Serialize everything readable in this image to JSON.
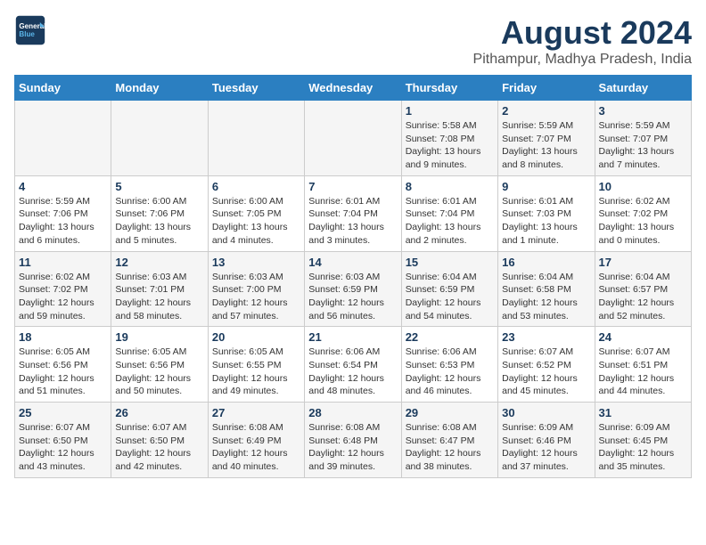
{
  "header": {
    "logo_line1": "General",
    "logo_line2": "Blue",
    "main_title": "August 2024",
    "subtitle": "Pithampur, Madhya Pradesh, India"
  },
  "days_of_week": [
    "Sunday",
    "Monday",
    "Tuesday",
    "Wednesday",
    "Thursday",
    "Friday",
    "Saturday"
  ],
  "weeks": [
    [
      {
        "day": "",
        "detail": ""
      },
      {
        "day": "",
        "detail": ""
      },
      {
        "day": "",
        "detail": ""
      },
      {
        "day": "",
        "detail": ""
      },
      {
        "day": "1",
        "detail": "Sunrise: 5:58 AM\nSunset: 7:08 PM\nDaylight: 13 hours and 9 minutes."
      },
      {
        "day": "2",
        "detail": "Sunrise: 5:59 AM\nSunset: 7:07 PM\nDaylight: 13 hours and 8 minutes."
      },
      {
        "day": "3",
        "detail": "Sunrise: 5:59 AM\nSunset: 7:07 PM\nDaylight: 13 hours and 7 minutes."
      }
    ],
    [
      {
        "day": "4",
        "detail": "Sunrise: 5:59 AM\nSunset: 7:06 PM\nDaylight: 13 hours and 6 minutes."
      },
      {
        "day": "5",
        "detail": "Sunrise: 6:00 AM\nSunset: 7:06 PM\nDaylight: 13 hours and 5 minutes."
      },
      {
        "day": "6",
        "detail": "Sunrise: 6:00 AM\nSunset: 7:05 PM\nDaylight: 13 hours and 4 minutes."
      },
      {
        "day": "7",
        "detail": "Sunrise: 6:01 AM\nSunset: 7:04 PM\nDaylight: 13 hours and 3 minutes."
      },
      {
        "day": "8",
        "detail": "Sunrise: 6:01 AM\nSunset: 7:04 PM\nDaylight: 13 hours and 2 minutes."
      },
      {
        "day": "9",
        "detail": "Sunrise: 6:01 AM\nSunset: 7:03 PM\nDaylight: 13 hours and 1 minute."
      },
      {
        "day": "10",
        "detail": "Sunrise: 6:02 AM\nSunset: 7:02 PM\nDaylight: 13 hours and 0 minutes."
      }
    ],
    [
      {
        "day": "11",
        "detail": "Sunrise: 6:02 AM\nSunset: 7:02 PM\nDaylight: 12 hours and 59 minutes."
      },
      {
        "day": "12",
        "detail": "Sunrise: 6:03 AM\nSunset: 7:01 PM\nDaylight: 12 hours and 58 minutes."
      },
      {
        "day": "13",
        "detail": "Sunrise: 6:03 AM\nSunset: 7:00 PM\nDaylight: 12 hours and 57 minutes."
      },
      {
        "day": "14",
        "detail": "Sunrise: 6:03 AM\nSunset: 6:59 PM\nDaylight: 12 hours and 56 minutes."
      },
      {
        "day": "15",
        "detail": "Sunrise: 6:04 AM\nSunset: 6:59 PM\nDaylight: 12 hours and 54 minutes."
      },
      {
        "day": "16",
        "detail": "Sunrise: 6:04 AM\nSunset: 6:58 PM\nDaylight: 12 hours and 53 minutes."
      },
      {
        "day": "17",
        "detail": "Sunrise: 6:04 AM\nSunset: 6:57 PM\nDaylight: 12 hours and 52 minutes."
      }
    ],
    [
      {
        "day": "18",
        "detail": "Sunrise: 6:05 AM\nSunset: 6:56 PM\nDaylight: 12 hours and 51 minutes."
      },
      {
        "day": "19",
        "detail": "Sunrise: 6:05 AM\nSunset: 6:56 PM\nDaylight: 12 hours and 50 minutes."
      },
      {
        "day": "20",
        "detail": "Sunrise: 6:05 AM\nSunset: 6:55 PM\nDaylight: 12 hours and 49 minutes."
      },
      {
        "day": "21",
        "detail": "Sunrise: 6:06 AM\nSunset: 6:54 PM\nDaylight: 12 hours and 48 minutes."
      },
      {
        "day": "22",
        "detail": "Sunrise: 6:06 AM\nSunset: 6:53 PM\nDaylight: 12 hours and 46 minutes."
      },
      {
        "day": "23",
        "detail": "Sunrise: 6:07 AM\nSunset: 6:52 PM\nDaylight: 12 hours and 45 minutes."
      },
      {
        "day": "24",
        "detail": "Sunrise: 6:07 AM\nSunset: 6:51 PM\nDaylight: 12 hours and 44 minutes."
      }
    ],
    [
      {
        "day": "25",
        "detail": "Sunrise: 6:07 AM\nSunset: 6:50 PM\nDaylight: 12 hours and 43 minutes."
      },
      {
        "day": "26",
        "detail": "Sunrise: 6:07 AM\nSunset: 6:50 PM\nDaylight: 12 hours and 42 minutes."
      },
      {
        "day": "27",
        "detail": "Sunrise: 6:08 AM\nSunset: 6:49 PM\nDaylight: 12 hours and 40 minutes."
      },
      {
        "day": "28",
        "detail": "Sunrise: 6:08 AM\nSunset: 6:48 PM\nDaylight: 12 hours and 39 minutes."
      },
      {
        "day": "29",
        "detail": "Sunrise: 6:08 AM\nSunset: 6:47 PM\nDaylight: 12 hours and 38 minutes."
      },
      {
        "day": "30",
        "detail": "Sunrise: 6:09 AM\nSunset: 6:46 PM\nDaylight: 12 hours and 37 minutes."
      },
      {
        "day": "31",
        "detail": "Sunrise: 6:09 AM\nSunset: 6:45 PM\nDaylight: 12 hours and 35 minutes."
      }
    ]
  ]
}
